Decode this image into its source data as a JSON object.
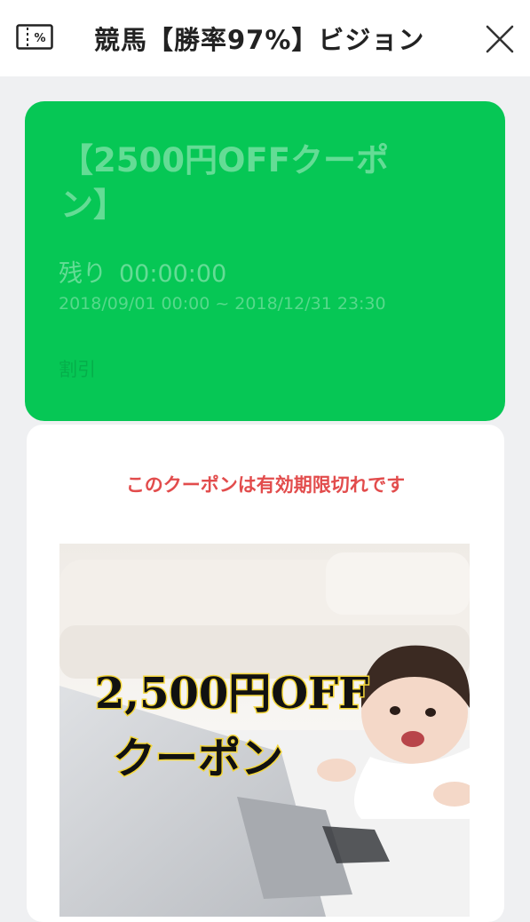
{
  "header": {
    "title": "競馬【勝率97%】ビジョン",
    "coupon_icon": "coupon-ticket-icon",
    "close_icon": "close-icon"
  },
  "coupon": {
    "title": "【2500円OFFクーポン】",
    "remaining_label": "残り",
    "remaining_time": "00:00:00",
    "period": "2018/09/01 00:00 ~ 2018/12/31 23:30",
    "type": "割引",
    "color": "#06c755"
  },
  "detail": {
    "expired_message": "このクーポンは有効期限切れです",
    "expired_color": "#e24c4c",
    "image_text_line1": "2,500円OFF",
    "image_text_line2": "クーポン"
  }
}
